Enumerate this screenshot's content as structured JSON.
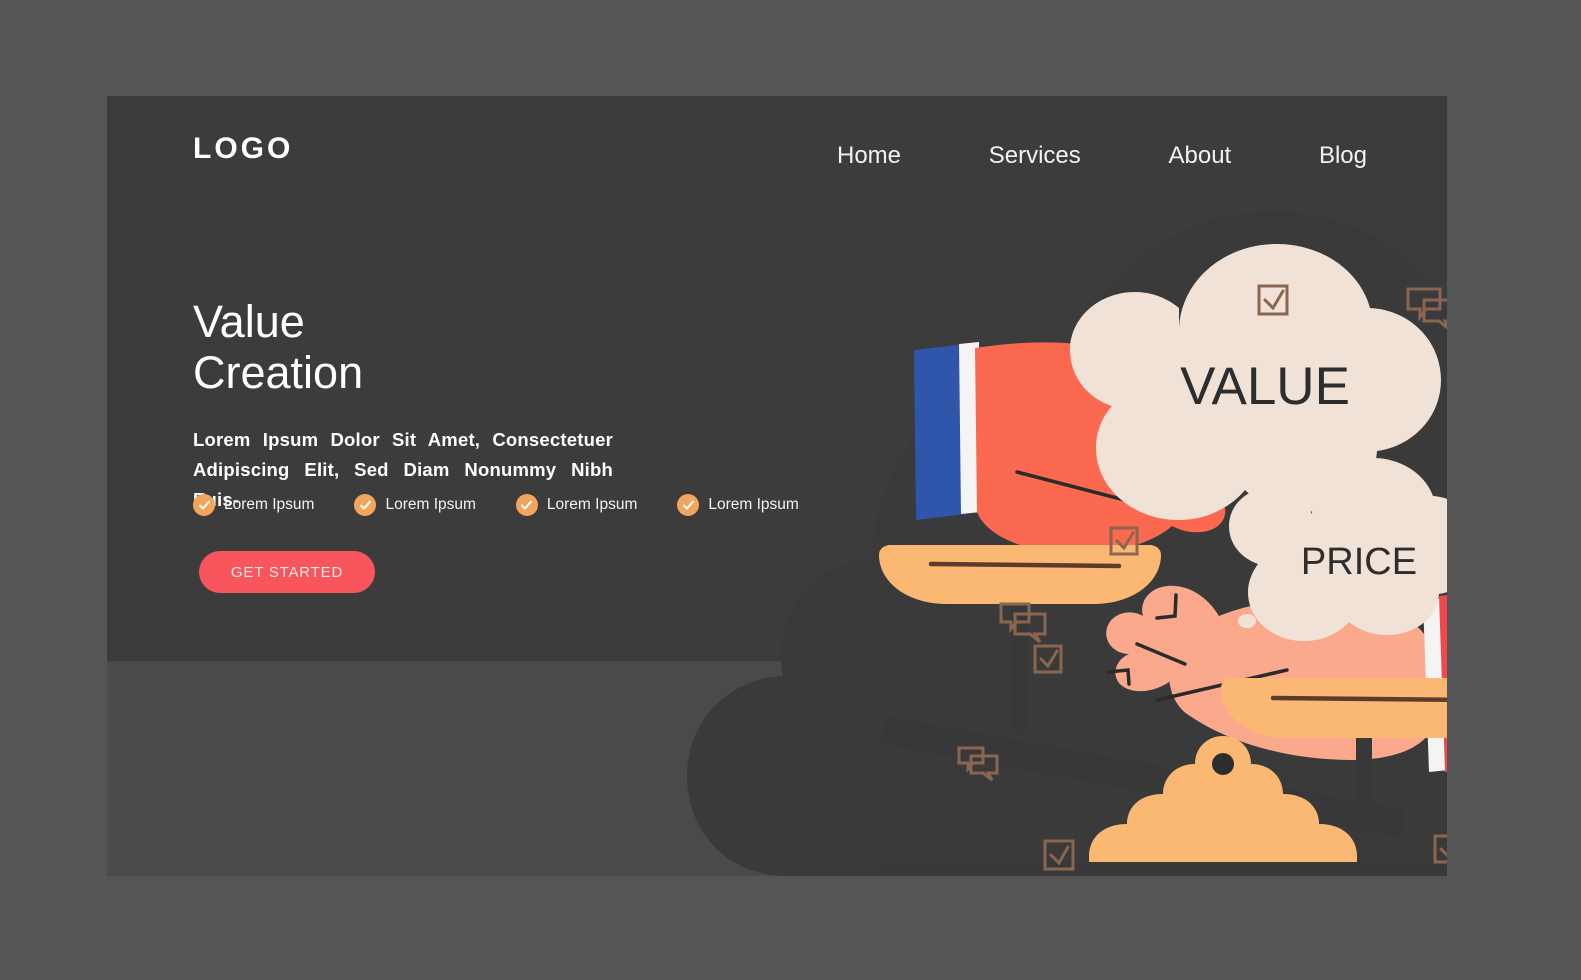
{
  "brand": {
    "logo": "LOGO"
  },
  "nav": {
    "items": [
      {
        "label": "Home"
      },
      {
        "label": "Services"
      },
      {
        "label": "About"
      },
      {
        "label": "Blog"
      }
    ]
  },
  "hero": {
    "title_line1": "Value",
    "title_line2": "Creation",
    "paragraph": "Lorem Ipsum Dolor Sit Amet, Consectetuer Adipiscing Elit, Sed Diam Nonummy Nibh Euis-",
    "features": [
      {
        "label": "Lorem Ipsum",
        "icon": "check-circle-icon"
      },
      {
        "label": "Lorem Ipsum",
        "icon": "check-circle-icon"
      },
      {
        "label": "Lorem Ipsum",
        "icon": "check-circle-icon"
      },
      {
        "label": "Lorem Ipsum",
        "icon": "check-circle-icon"
      }
    ],
    "cta_label": "GET STARTED"
  },
  "illustration": {
    "value_bubble_text": "VALUE",
    "price_bubble_text": "PRICE",
    "left_hand": {
      "cuff": "blue-suit-cuff",
      "skin": "coral"
    },
    "right_hand": {
      "cuff": "red-suit-cuff",
      "skin": "peach"
    },
    "scale": "balance-scale-tilted-left"
  },
  "colors": {
    "page_background": "#555555",
    "card_background": "#4a4a4a",
    "panel_dark": "#3c3c3c",
    "blob": "#3a3a3a",
    "accent_orange": "#f2a55c",
    "cta_red": "#f9555c",
    "bubble_cream": "#f1e2d8",
    "pan_orange": "#fbb872",
    "hand_coral": "#fb6a50",
    "hand_peach": "#fba98d",
    "cuff_blue": "#2f56ab",
    "cuff_red": "#f2484c",
    "beam_dark": "#383838",
    "decor_outline": "#8a6650",
    "text_white": "#ffffff"
  }
}
